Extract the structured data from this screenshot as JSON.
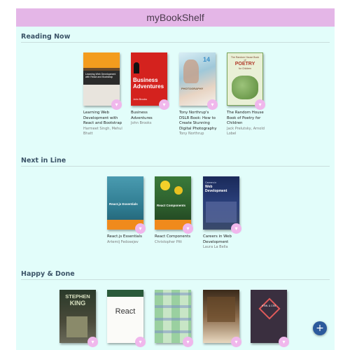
{
  "app": {
    "title": "myBookShelf"
  },
  "shelves": [
    {
      "title": "Reading Now",
      "books": [
        {
          "title": "Learning Web Development with React and Bootstrap",
          "author": "Harmeet Singh, Mehul Bhatt"
        },
        {
          "title": "Business Adventures",
          "author": "John Brooks"
        },
        {
          "title": "Tony Northrup's DSLR Book: How to Create Stunning Digital Photography",
          "author": "Tony Northrup"
        },
        {
          "title": "The Random House Book of Poetry for Children",
          "author": "Jack Prelutsky, Arnold Lobel"
        }
      ]
    },
    {
      "title": "Next in Line",
      "books": [
        {
          "title": "React.js Essentials",
          "author": "Artemij Fedosejev"
        },
        {
          "title": "React Components",
          "author": "Christopher Pitt"
        },
        {
          "title": "Careers in Web Development",
          "author": "Laura La Bella"
        }
      ]
    },
    {
      "title": "Happy & Done",
      "books": [
        {
          "title": "",
          "author": ""
        },
        {
          "title": "",
          "author": ""
        },
        {
          "title": "",
          "author": ""
        },
        {
          "title": "",
          "author": ""
        },
        {
          "title": "",
          "author": ""
        }
      ]
    }
  ],
  "covers": {
    "learning_web_dev": "Learning Web Development with React and Bootstrap",
    "business_adventures_1": "Business",
    "business_adventures_2": "Adventures",
    "business_adventures_author": "John Brooks",
    "dslr_num": "14",
    "dslr_word": "PHOTOGRAPHY",
    "poetry_1": "The Random House Book of",
    "poetry_2": "POETRY",
    "poetry_3": "for Children",
    "react_essentials": "React.js Essentials",
    "react_components": "React Components",
    "careers_1": "Careers in",
    "careers_2": "Web",
    "careers_3": "Development",
    "stephen_king_1": "STEPHEN",
    "stephen_king_2": "KING",
    "react_plain": "React",
    "html_css": "HTML & CSS",
    "fab_symbol": "+",
    "move_symbol": "▾"
  },
  "colors": {
    "header_bg": "#e4b6e7",
    "shelf_bg": "#e2fdfa",
    "shelf_title": "#3c5468",
    "move_button": "#f0b7ec",
    "fab": "#2c5a9c"
  }
}
